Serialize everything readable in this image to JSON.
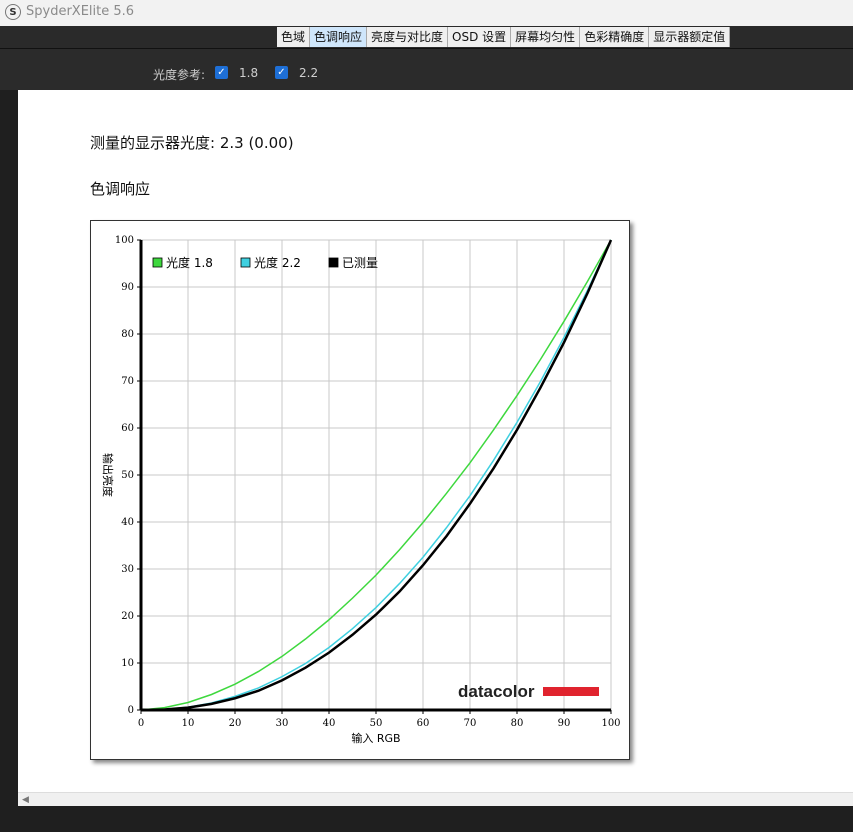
{
  "app": {
    "title": "SpyderXElite 5.6",
    "logo_letter": "S"
  },
  "tabs": [
    {
      "label": "色域",
      "active": false
    },
    {
      "label": "色调响应",
      "active": true
    },
    {
      "label": "亮度与对比度",
      "active": false
    },
    {
      "label": "OSD 设置",
      "active": false
    },
    {
      "label": "屏幕均匀性",
      "active": false
    },
    {
      "label": "色彩精确度",
      "active": false
    },
    {
      "label": "显示器额定值",
      "active": false
    }
  ],
  "options": {
    "label": "光度参考:",
    "checkboxes": [
      {
        "label": "1.8",
        "checked": true
      },
      {
        "label": "2.2",
        "checked": true
      }
    ]
  },
  "report": {
    "measured_text": "测量的显示器光度:  2.3 (0.00)",
    "section_title": "色调响应"
  },
  "brand": {
    "name": "datacolor",
    "bar_color": "#e0232e"
  },
  "chart_data": {
    "type": "line",
    "xlabel": "输入 RGB",
    "ylabel": "输出亮度",
    "xlim": [
      0,
      100
    ],
    "ylim": [
      0,
      100
    ],
    "xticks": [
      0,
      10,
      20,
      30,
      40,
      50,
      60,
      70,
      80,
      90,
      100
    ],
    "yticks": [
      0,
      10,
      20,
      30,
      40,
      50,
      60,
      70,
      80,
      90,
      100
    ],
    "grid": true,
    "legend_position": "top-left",
    "x": [
      0,
      5,
      10,
      15,
      20,
      25,
      30,
      35,
      40,
      45,
      50,
      55,
      60,
      65,
      70,
      75,
      80,
      85,
      90,
      95,
      100
    ],
    "series": [
      {
        "name": "光度 1.8",
        "color": "#3ed83e",
        "values": [
          0,
          0.5,
          1.6,
          3.3,
          5.5,
          8.2,
          11.4,
          15.1,
          19.2,
          23.8,
          28.7,
          34.1,
          39.9,
          46.1,
          52.6,
          59.6,
          66.9,
          74.6,
          82.7,
          91.2,
          100
        ]
      },
      {
        "name": "光度 2.2",
        "color": "#3fd0e0",
        "values": [
          0,
          0.1,
          0.6,
          1.5,
          2.9,
          4.7,
          7.1,
          9.9,
          13.3,
          17.3,
          21.8,
          26.9,
          32.5,
          38.8,
          45.6,
          53.1,
          61.2,
          69.9,
          79.3,
          89.3,
          100
        ]
      },
      {
        "name": "已测量",
        "color": "#000000",
        "values": [
          0,
          0.1,
          0.5,
          1.3,
          2.5,
          4.1,
          6.3,
          9.0,
          12.2,
          16.0,
          20.3,
          25.2,
          30.8,
          37.0,
          43.9,
          51.4,
          59.6,
          68.6,
          78.2,
          88.7,
          100
        ]
      }
    ]
  }
}
